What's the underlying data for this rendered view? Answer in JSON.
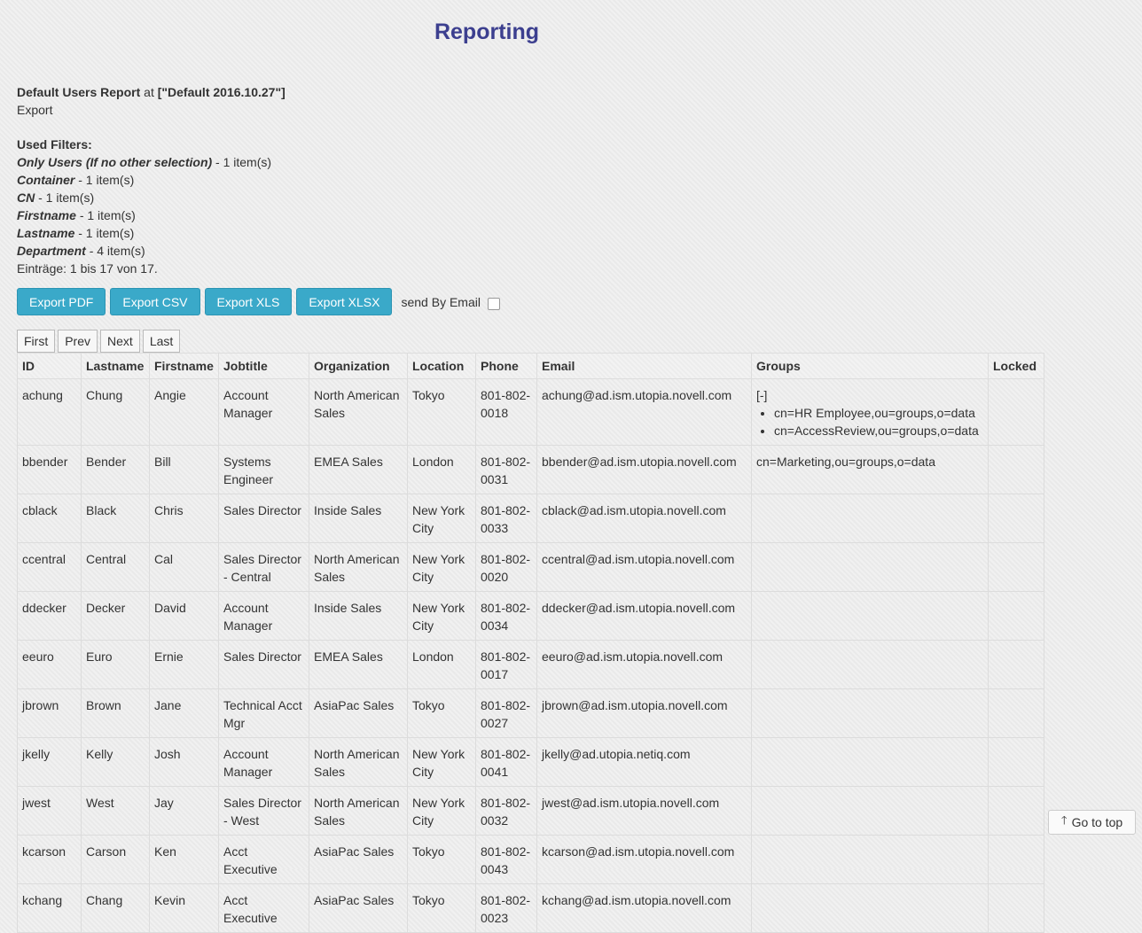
{
  "header": {
    "title": "Reporting"
  },
  "report": {
    "name": "Default Users Report",
    "at_word": "at",
    "config": "[\"Default 2016.10.27\"]",
    "subtitle": "Export",
    "filters_heading": "Used Filters:",
    "filters": [
      {
        "name": "Only Users (If no other selection)",
        "count": "- 1 item(s)"
      },
      {
        "name": "Container",
        "count": "- 1 item(s)"
      },
      {
        "name": "CN",
        "count": "- 1 item(s)"
      },
      {
        "name": "Firstname",
        "count": "- 1 item(s)"
      },
      {
        "name": "Lastname",
        "count": "- 1 item(s)"
      },
      {
        "name": "Department",
        "count": "- 4 item(s)"
      }
    ],
    "entries_text": "Einträge: 1 bis 17 von 17."
  },
  "export": {
    "pdf": "Export PDF",
    "csv": "Export CSV",
    "xls": "Export XLS",
    "xlsx": "Export XLSX",
    "email_label": "send By Email"
  },
  "pager": {
    "first": "First",
    "prev": "Prev",
    "next": "Next",
    "last": "Last"
  },
  "table": {
    "headers": [
      "ID",
      "Lastname",
      "Firstname",
      "Jobtitle",
      "Organization",
      "Location",
      "Phone",
      "Email",
      "Groups",
      "Locked"
    ],
    "rows": [
      {
        "id": "achung",
        "last": "Chung",
        "first": "Angie",
        "job": "Account Manager",
        "org": "North American Sales",
        "loc": "Tokyo",
        "phone": "801-802-0018",
        "email": "achung@ad.ism.utopia.novell.com",
        "groups_toggle": "[-]",
        "groups_list": [
          "cn=HR Employee,ou=groups,o=data",
          "cn=AccessReview,ou=groups,o=data"
        ],
        "locked": ""
      },
      {
        "id": "bbender",
        "last": "Bender",
        "first": "Bill",
        "job": "Systems Engineer",
        "org": "EMEA Sales",
        "loc": "London",
        "phone": "801-802-0031",
        "email": "bbender@ad.ism.utopia.novell.com",
        "groups": "cn=Marketing,ou=groups,o=data",
        "locked": ""
      },
      {
        "id": "cblack",
        "last": "Black",
        "first": "Chris",
        "job": "Sales Director",
        "org": "Inside Sales",
        "loc": "New York City",
        "phone": "801-802-0033",
        "email": "cblack@ad.ism.utopia.novell.com",
        "groups": "",
        "locked": ""
      },
      {
        "id": "ccentral",
        "last": "Central",
        "first": "Cal",
        "job": "Sales Director - Central",
        "org": "North American Sales",
        "loc": "New York City",
        "phone": "801-802-0020",
        "email": "ccentral@ad.ism.utopia.novell.com",
        "groups": "",
        "locked": ""
      },
      {
        "id": "ddecker",
        "last": "Decker",
        "first": "David",
        "job": "Account Manager",
        "org": "Inside Sales",
        "loc": "New York City",
        "phone": "801-802-0034",
        "email": "ddecker@ad.ism.utopia.novell.com",
        "groups": "",
        "locked": ""
      },
      {
        "id": "eeuro",
        "last": "Euro",
        "first": "Ernie",
        "job": "Sales Director",
        "org": "EMEA Sales",
        "loc": "London",
        "phone": "801-802-0017",
        "email": "eeuro@ad.ism.utopia.novell.com",
        "groups": "",
        "locked": ""
      },
      {
        "id": "jbrown",
        "last": "Brown",
        "first": "Jane",
        "job": "Technical Acct Mgr",
        "org": "AsiaPac Sales",
        "loc": "Tokyo",
        "phone": "801-802-0027",
        "email": "jbrown@ad.ism.utopia.novell.com",
        "groups": "",
        "locked": ""
      },
      {
        "id": "jkelly",
        "last": "Kelly",
        "first": "Josh",
        "job": "Account Manager",
        "org": "North American Sales",
        "loc": "New York City",
        "phone": "801-802-0041",
        "email": "jkelly@ad.utopia.netiq.com",
        "groups": "",
        "locked": ""
      },
      {
        "id": "jwest",
        "last": "West",
        "first": "Jay",
        "job": "Sales Director - West",
        "org": "North American Sales",
        "loc": "New York City",
        "phone": "801-802-0032",
        "email": "jwest@ad.ism.utopia.novell.com",
        "groups": "",
        "locked": ""
      },
      {
        "id": "kcarson",
        "last": "Carson",
        "first": "Ken",
        "job": "Acct Executive",
        "org": "AsiaPac Sales",
        "loc": "Tokyo",
        "phone": "801-802-0043",
        "email": "kcarson@ad.ism.utopia.novell.com",
        "groups": "",
        "locked": ""
      },
      {
        "id": "kchang",
        "last": "Chang",
        "first": "Kevin",
        "job": "Acct Executive",
        "org": "AsiaPac Sales",
        "loc": "Tokyo",
        "phone": "801-802-0023",
        "email": "kchang@ad.ism.utopia.novell.com",
        "groups": "",
        "locked": ""
      }
    ]
  },
  "go_to_top": {
    "label": "Go to top",
    "icon": "arrow-up-icon"
  },
  "colors": {
    "title": "#3c3f8f",
    "export_button": "#3aa9c9"
  }
}
